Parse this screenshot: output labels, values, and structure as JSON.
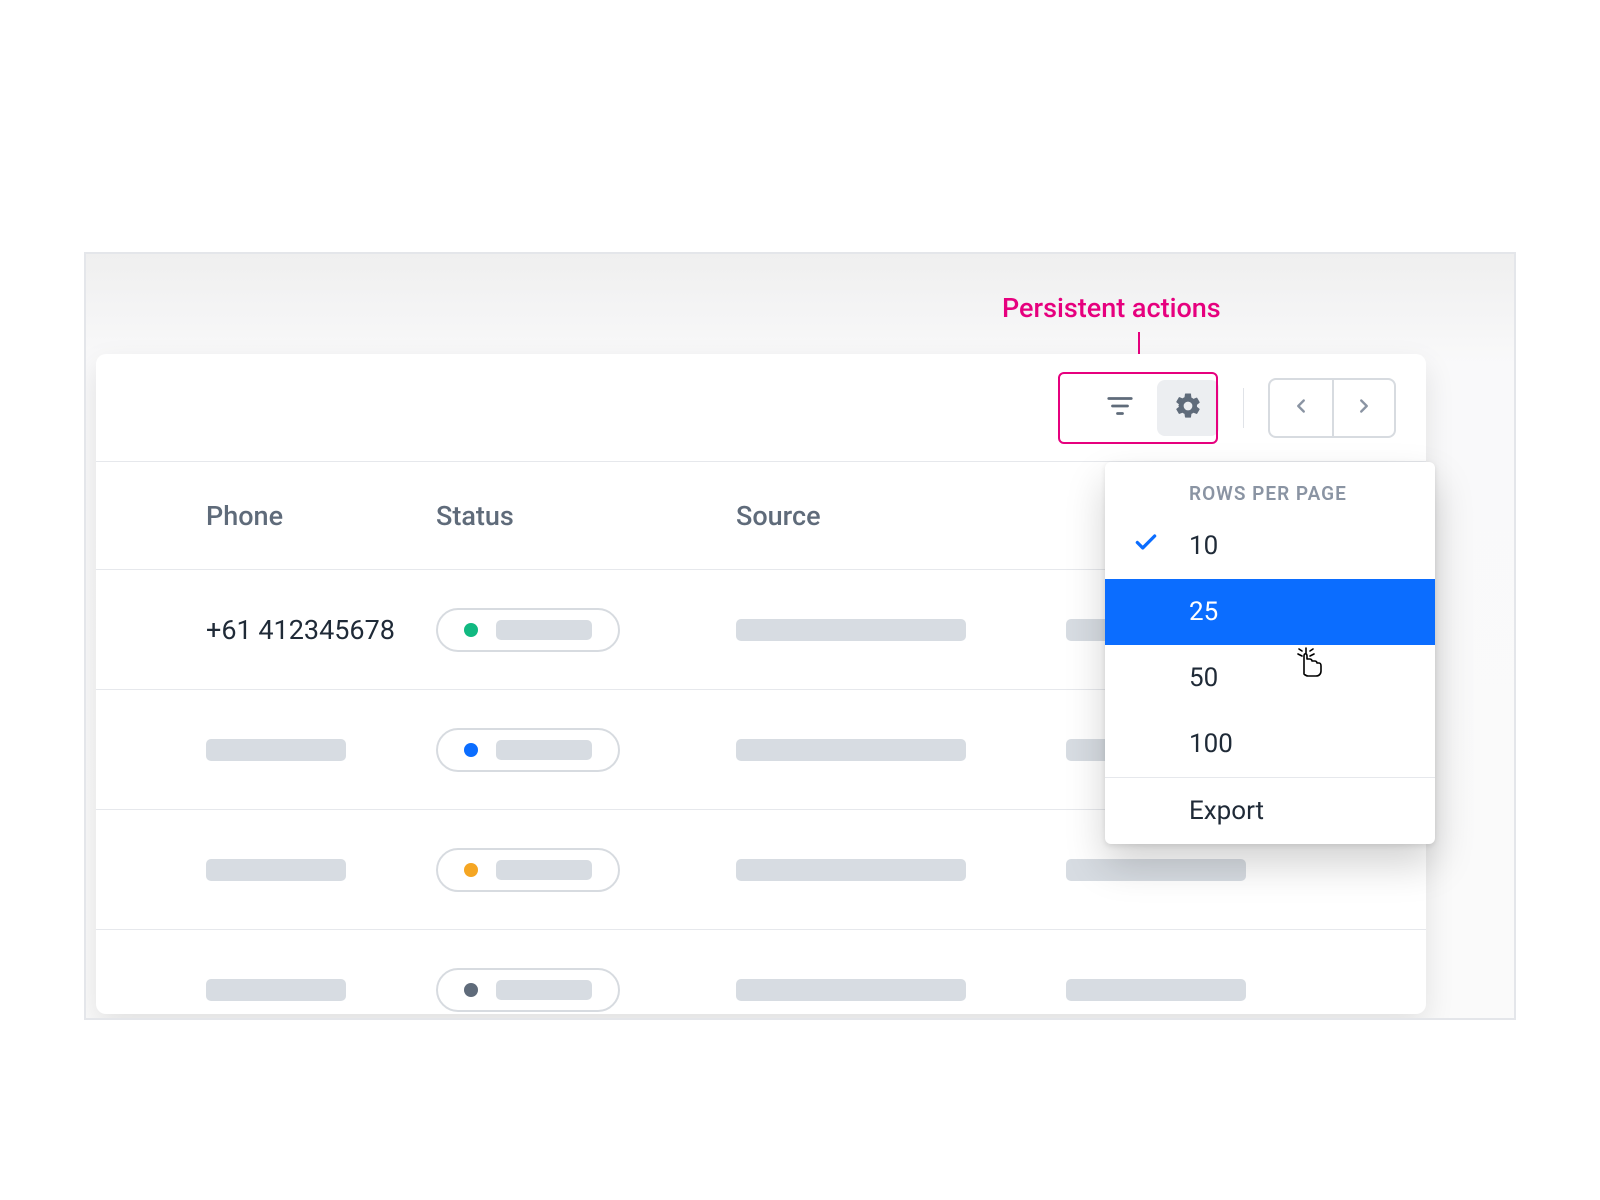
{
  "annotation": {
    "label": "Persistent actions"
  },
  "columns": {
    "phone": "Phone",
    "status": "Status",
    "source": "Source"
  },
  "rows": [
    {
      "phone": "+61 412345678",
      "status_color": "#11b981"
    },
    {
      "phone": "",
      "status_color": "#0b6dff"
    },
    {
      "phone": "",
      "status_color": "#f5a623"
    },
    {
      "phone": "",
      "status_color": "#5f6b7a"
    }
  ],
  "menu": {
    "header": "ROWS PER PAGE",
    "options": [
      "10",
      "25",
      "50",
      "100"
    ],
    "selected_index": 0,
    "hover_index": 1,
    "export_label": "Export"
  },
  "colors": {
    "accent_blue": "#0b6dff",
    "annotation_pink": "#e6007e"
  }
}
